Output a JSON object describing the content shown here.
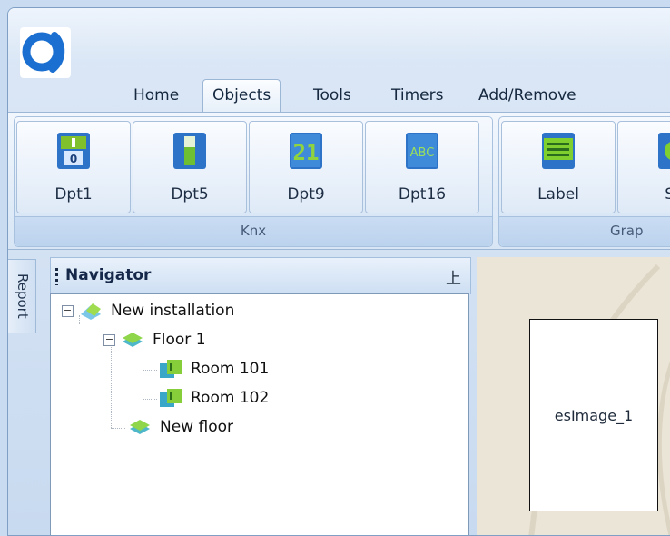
{
  "tabs": [
    "Home",
    "Objects",
    "Tools",
    "Timers",
    "Add/Remove"
  ],
  "active_tab": "Objects",
  "ribbon": {
    "knx_group": {
      "caption": "Knx",
      "buttons": [
        {
          "label": "Dpt1",
          "icon": "switch-icon"
        },
        {
          "label": "Dpt5",
          "icon": "level-icon"
        },
        {
          "label": "Dpt9",
          "icon": "digits-icon"
        },
        {
          "label": "Dpt16",
          "icon": "abc-text-icon"
        }
      ]
    },
    "graphics_group": {
      "caption": "Grap",
      "buttons": [
        {
          "label": "Label",
          "icon": "label-icon"
        },
        {
          "label": "Sh",
          "icon": "shape-icon"
        }
      ]
    },
    "digits_glyph": "21",
    "abc_glyph": "ABC",
    "switch_glyph": "0"
  },
  "report_tab": "Report",
  "navigator": {
    "title": "Navigator",
    "pin_glyph": "上",
    "tree": [
      {
        "label": "New installation",
        "icon": "installation-icon",
        "expander": "−"
      },
      {
        "label": "Floor 1",
        "icon": "floor-icon",
        "expander": "−"
      },
      {
        "label": "Room 101",
        "icon": "room-icon"
      },
      {
        "label": "Room 102",
        "icon": "room-icon"
      },
      {
        "label": "New floor",
        "icon": "floor-icon"
      }
    ]
  },
  "canvas": {
    "image_object_label": "esImage_1"
  },
  "colors": {
    "ribbon_bg": "#dce9f7",
    "accent_blue": "#1a6fd1",
    "canvas_bg": "#ebe5d8"
  }
}
